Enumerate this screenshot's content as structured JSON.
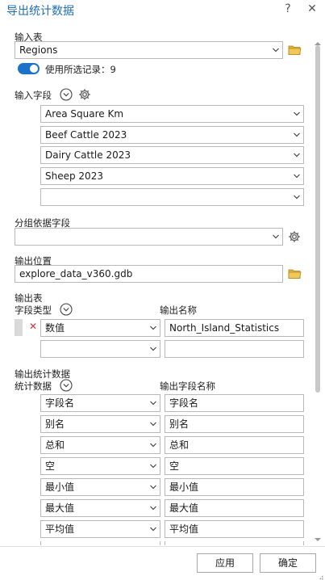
{
  "window": {
    "title": "导出统计数据",
    "help": "?",
    "close": "✕"
  },
  "input_table": {
    "label": "输入表",
    "value": "Regions",
    "use_selected": {
      "label": "使用所选记录：",
      "count": "9",
      "enabled": true
    }
  },
  "input_fields": {
    "label": "输入字段",
    "items": [
      "Area Square Km",
      "Beef Cattle 2023",
      "Dairy Cattle 2023",
      "Sheep 2023",
      ""
    ]
  },
  "group_by": {
    "label": "分组依据字段",
    "value": ""
  },
  "output_location": {
    "label": "输出位置",
    "value": "explore_data_v360.gdb"
  },
  "output_table": {
    "label": "输出表",
    "field_type_header": "字段类型",
    "output_name_header": "输出名称",
    "rows": [
      {
        "type": "数值",
        "name": "North_Island_Statistics"
      },
      {
        "type": "",
        "name": ""
      }
    ]
  },
  "output_stats": {
    "label": "输出统计数据",
    "stat_header": "统计数据",
    "field_name_header": "输出字段名称",
    "rows": [
      {
        "stat": "字段名",
        "name": "字段名"
      },
      {
        "stat": "别名",
        "name": "别名"
      },
      {
        "stat": "总和",
        "name": "总和"
      },
      {
        "stat": "空",
        "name": "空"
      },
      {
        "stat": "最小值",
        "name": "最小值"
      },
      {
        "stat": "最大值",
        "name": "最大值"
      },
      {
        "stat": "平均值",
        "name": "平均值"
      }
    ]
  },
  "buttons": {
    "apply": "应用",
    "ok": "确定"
  },
  "colors": {
    "accent": "#1f6fb2",
    "toggle": "#1a73c8",
    "folder": "#e3b23c",
    "remove": "#d13438"
  }
}
